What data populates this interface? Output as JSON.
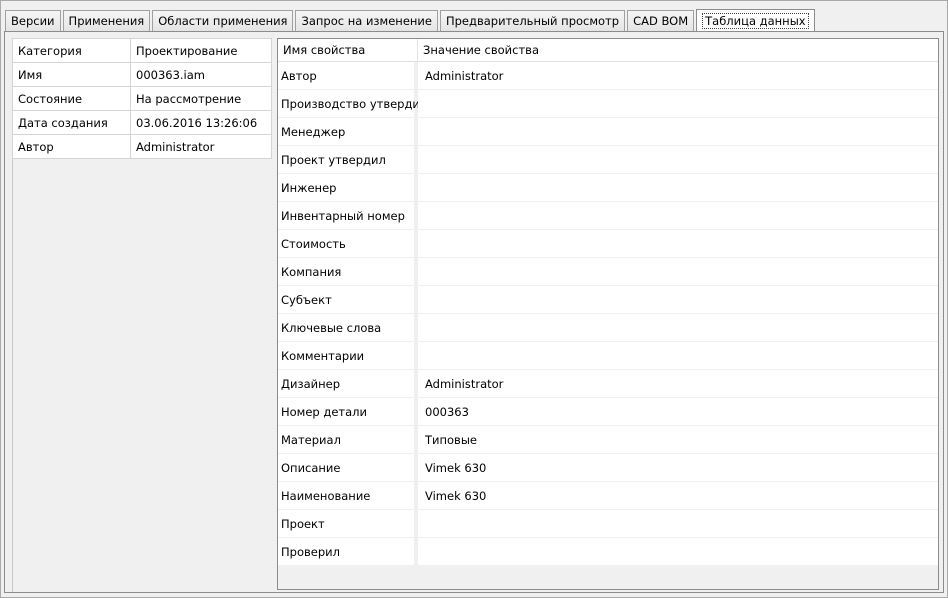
{
  "tabs": [
    {
      "label": "Версии",
      "active": false
    },
    {
      "label": "Применения",
      "active": false
    },
    {
      "label": "Области применения",
      "active": false
    },
    {
      "label": "Запрос на изменение",
      "active": false
    },
    {
      "label": "Предварительный просмотр",
      "active": false
    },
    {
      "label": "CAD BOM",
      "active": false
    },
    {
      "label": "Таблица данных",
      "active": true
    }
  ],
  "summary": [
    {
      "key": "Категория",
      "value": "Проектирование"
    },
    {
      "key": "Имя",
      "value": "000363.iam"
    },
    {
      "key": "Состояние",
      "value": "На рассмотрение"
    },
    {
      "key": "Дата создания",
      "value": "03.06.2016 13:26:06"
    },
    {
      "key": "Автор",
      "value": "Administrator"
    }
  ],
  "properties": {
    "headers": {
      "name": "Имя свойства",
      "value": "Значение свойства"
    },
    "rows": [
      {
        "name": "Автор",
        "value": "Administrator"
      },
      {
        "name": "Производство утвердил",
        "value": ""
      },
      {
        "name": "Менеджер",
        "value": ""
      },
      {
        "name": "Проект утвердил",
        "value": ""
      },
      {
        "name": "Инженер",
        "value": ""
      },
      {
        "name": "Инвентарный номер",
        "value": ""
      },
      {
        "name": "Стоимость",
        "value": ""
      },
      {
        "name": "Компания",
        "value": ""
      },
      {
        "name": "Субъект",
        "value": ""
      },
      {
        "name": "Ключевые слова",
        "value": ""
      },
      {
        "name": "Комментарии",
        "value": ""
      },
      {
        "name": "Дизайнер",
        "value": "Administrator"
      },
      {
        "name": "Номер детали",
        "value": "000363"
      },
      {
        "name": "Материал",
        "value": "Типовые"
      },
      {
        "name": "Описание",
        "value": "Vimek 630"
      },
      {
        "name": "Наименование",
        "value": "Vimek 630"
      },
      {
        "name": "Проект",
        "value": ""
      },
      {
        "name": "Проверил",
        "value": ""
      }
    ]
  }
}
